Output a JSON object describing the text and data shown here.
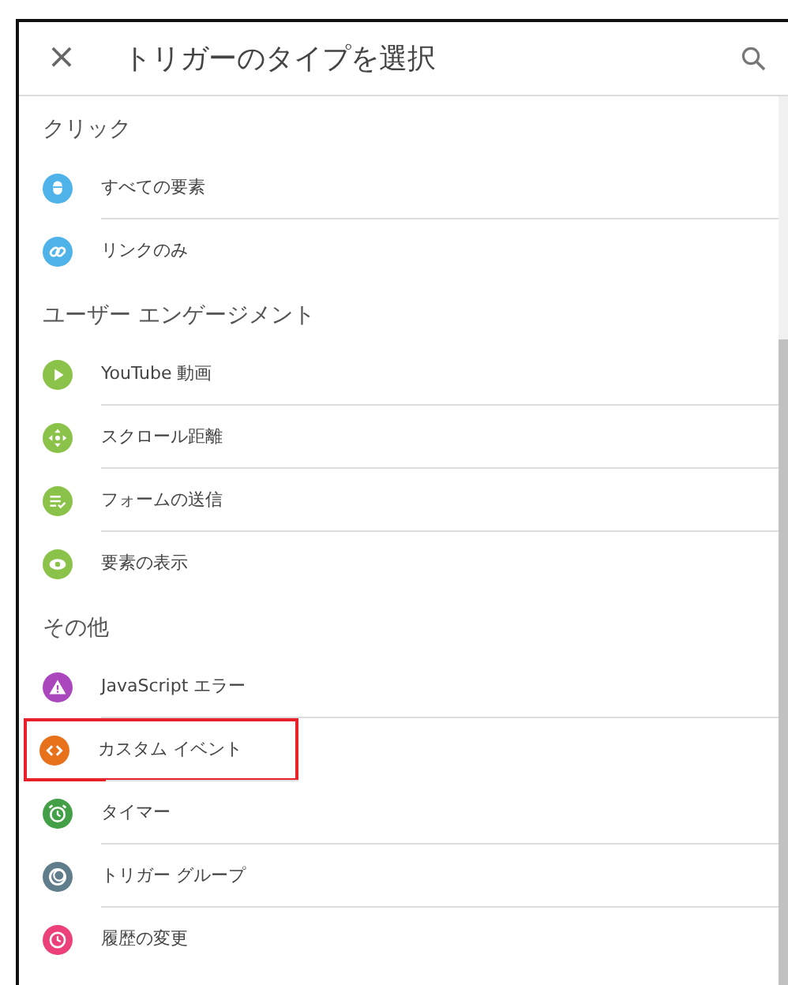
{
  "dialog": {
    "title": "トリガーのタイプを選択",
    "close_label": "×"
  },
  "sections": [
    {
      "heading": "クリック",
      "items": [
        {
          "label": "すべての要素",
          "color": "#4fb3ea",
          "highlighted": false
        },
        {
          "label": "リンクのみ",
          "color": "#4fb3ea",
          "highlighted": false
        }
      ]
    },
    {
      "heading": "ユーザー エンゲージメント",
      "items": [
        {
          "label": "YouTube 動画",
          "color": "#8bc34a",
          "highlighted": false
        },
        {
          "label": "スクロール距離",
          "color": "#8bc34a",
          "highlighted": false
        },
        {
          "label": "フォームの送信",
          "color": "#8bc34a",
          "highlighted": false
        },
        {
          "label": "要素の表示",
          "color": "#8bc34a",
          "highlighted": false
        }
      ]
    },
    {
      "heading": "その他",
      "items": [
        {
          "label": "JavaScript エラー",
          "color": "#ab47bc",
          "highlighted": false
        },
        {
          "label": "カスタム イベント",
          "color": "#e8711c",
          "highlighted": true
        },
        {
          "label": "タイマー",
          "color": "#43a047",
          "highlighted": false
        },
        {
          "label": "トリガー グループ",
          "color": "#607d8b",
          "highlighted": false
        },
        {
          "label": "履歴の変更",
          "color": "#ec407a",
          "highlighted": false
        }
      ]
    }
  ]
}
